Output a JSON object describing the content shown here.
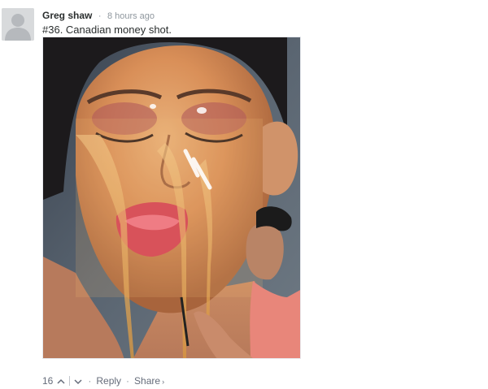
{
  "comment": {
    "author": "Greg shaw",
    "separator": "·",
    "time": "8 hours ago",
    "text": "#36. Canadian money shot.",
    "image_alt": "Hyperrealistic painting of a woman's face with honey dripping, with the painter at work"
  },
  "footer": {
    "vote_count": "16",
    "upvote_icon": "chevron-up-icon",
    "downvote_icon": "chevron-down-icon",
    "bullet": "·",
    "reply_label": "Reply",
    "share_label": "Share",
    "share_chevron": "›"
  },
  "colors": {
    "author": "#2a2e2e",
    "meta": "#8f979e",
    "action": "#656c7a",
    "avatar_bg": "#d8dadc"
  }
}
